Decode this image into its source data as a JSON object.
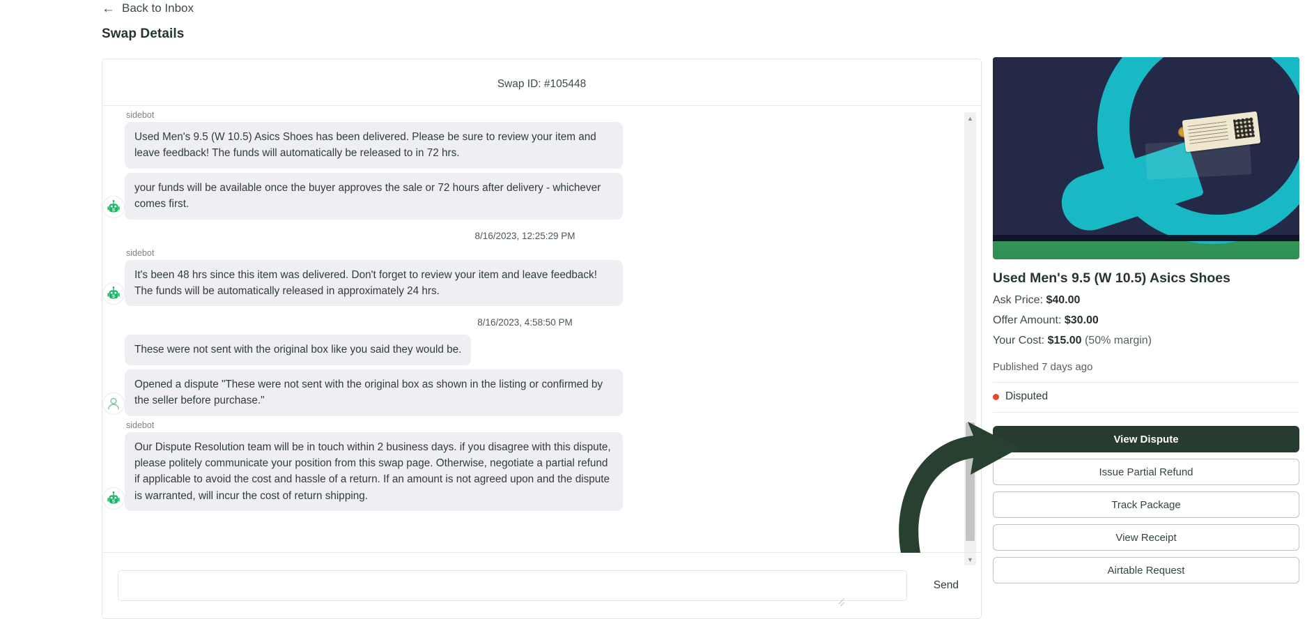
{
  "nav": {
    "back_label": "Back to Inbox",
    "back_icon": "arrow-left-icon"
  },
  "header": {
    "title": "Swap Details"
  },
  "chat": {
    "swap_id_label": "Swap ID: #105448",
    "sender_bot": "sidebot",
    "messages": [
      {
        "sender": "sidebot",
        "avatar": "robot-bot-icon",
        "show_sender": true,
        "show_avatar": false,
        "text": "Used Men's 9.5 (W 10.5) Asics Shoes has been delivered. Please be sure to review your item and leave            feedback! The funds will automatically be released to                    in 72 hrs."
      },
      {
        "sender": "sidebot",
        "avatar": "robot-bot-icon",
        "show_sender": false,
        "show_avatar": true,
        "text": "             your funds will be available once the buyer approves the sale or 72 hours after delivery - whichever comes first."
      },
      {
        "sender": "sidebot",
        "avatar": "robot-bot-icon",
        "show_sender": true,
        "show_avatar": true,
        "timestamp": "8/16/2023, 12:25:29 PM",
        "text": "It's been 48 hrs since this item was delivered. Don't forget to review your item and leave                feedback! The funds will be automatically released in approximately 24 hrs."
      },
      {
        "sender": "buyer",
        "avatar": "user-person-icon",
        "show_sender": false,
        "show_avatar": false,
        "timestamp": "8/16/2023, 4:58:50 PM",
        "text": "These were not sent with the original box like you said they would be."
      },
      {
        "sender": "buyer",
        "avatar": "user-person-icon",
        "show_sender": false,
        "show_avatar": true,
        "text": "Opened a dispute \"These were not sent with the original box as shown in the listing or confirmed by the seller before purchase.\""
      },
      {
        "sender": "sidebot",
        "avatar": "robot-bot-icon",
        "show_sender": true,
        "show_avatar": true,
        "text": "Our Dispute Resolution team will be in touch within 2 business days.                    if you disagree with this dispute, please politely communicate your position from this swap page. Otherwise, negotiate a partial refund if applicable to avoid the cost and hassle of a return. If an amount is not agreed upon and the dispute is warranted,                     will incur the cost of return shipping."
      }
    ],
    "timestamps": [
      "8/16/2023, 12:25:29 PM",
      "8/16/2023, 4:58:50 PM"
    ],
    "scrollbar": {
      "up_icon": "chevron-up-icon",
      "down_icon": "chevron-down-icon"
    }
  },
  "composer": {
    "value": "",
    "placeholder": "",
    "send_label": "Send"
  },
  "product": {
    "image_alt": "asics-shoe-box-photo",
    "title": "Used Men's 9.5 (W 10.5) Asics Shoes",
    "ask_price_label": "Ask Price:",
    "ask_price_value": "$40.00",
    "offer_amount_label": "Offer Amount:",
    "offer_amount_value": "$30.00",
    "your_cost_label": "Your Cost:",
    "your_cost_value": "$15.00",
    "your_cost_margin": "(50% margin)",
    "published": "Published 7 days ago",
    "status": "Disputed",
    "status_color": "#e8452f"
  },
  "actions": {
    "primary": {
      "label": "View Dispute"
    },
    "items": [
      {
        "label": "Issue Partial Refund"
      },
      {
        "label": "Track Package"
      },
      {
        "label": "View Receipt"
      },
      {
        "label": "Airtable Request"
      }
    ]
  },
  "annotation": {
    "arrow_color": "#27402f",
    "arrow_target": "view-dispute-button"
  }
}
